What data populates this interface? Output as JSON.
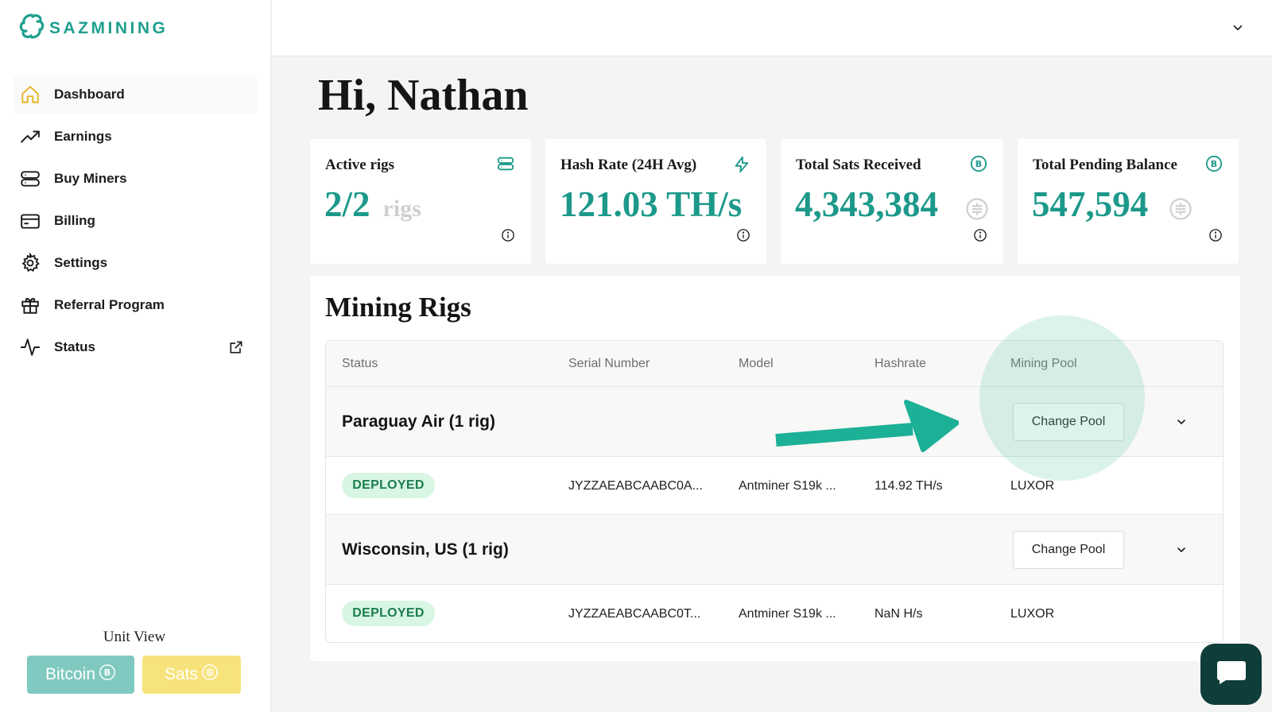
{
  "brand": {
    "name": "SAZMINING",
    "accent": "#1f9f8f"
  },
  "sidebar": {
    "items": [
      {
        "label": "Dashboard",
        "icon": "home-icon",
        "active": true
      },
      {
        "label": "Earnings",
        "icon": "trending-up-icon"
      },
      {
        "label": "Buy Miners",
        "icon": "server-icon"
      },
      {
        "label": "Billing",
        "icon": "credit-card-icon"
      },
      {
        "label": "Settings",
        "icon": "gear-icon"
      },
      {
        "label": "Referral Program",
        "icon": "gift-icon"
      },
      {
        "label": "Status",
        "icon": "activity-icon",
        "external": true
      }
    ],
    "unit_view": {
      "title": "Unit View",
      "bitcoin_label": "Bitcoin",
      "sats_label": "Sats"
    }
  },
  "header": {
    "greeting": "Hi, Nathan"
  },
  "stats": [
    {
      "title": "Active rigs",
      "value": "2/2",
      "unit": "rigs",
      "icon": "server-icon"
    },
    {
      "title": "Hash Rate (24H Avg)",
      "value": "121.03 TH/s",
      "icon": "lightning-icon"
    },
    {
      "title": "Total Sats Received",
      "value": "4,343,384",
      "icon": "bitcoin-icon",
      "coin_icon": "sats-icon"
    },
    {
      "title": "Total Pending Balance",
      "value": "547,594",
      "icon": "bitcoin-icon",
      "coin_icon": "sats-icon"
    }
  ],
  "mining_rigs": {
    "title": "Mining Rigs",
    "columns": [
      "Status",
      "Serial Number",
      "Model",
      "Hashrate",
      "Mining Pool"
    ],
    "change_pool_label": "Change Pool",
    "groups": [
      {
        "name": "Paraguay Air (1 rig)",
        "rigs": [
          {
            "status": "DEPLOYED",
            "serial": "JYZZAEABCAABC0A...",
            "model": "Antminer S19k ...",
            "hashrate": "114.92 TH/s",
            "pool": "LUXOR"
          }
        ]
      },
      {
        "name": "Wisconsin, US (1 rig)",
        "rigs": [
          {
            "status": "DEPLOYED",
            "serial": "JYZZAEABCAABC0T...",
            "model": "Antminer S19k ...",
            "hashrate": "NaN H/s",
            "pool": "LUXOR"
          }
        ]
      }
    ]
  }
}
